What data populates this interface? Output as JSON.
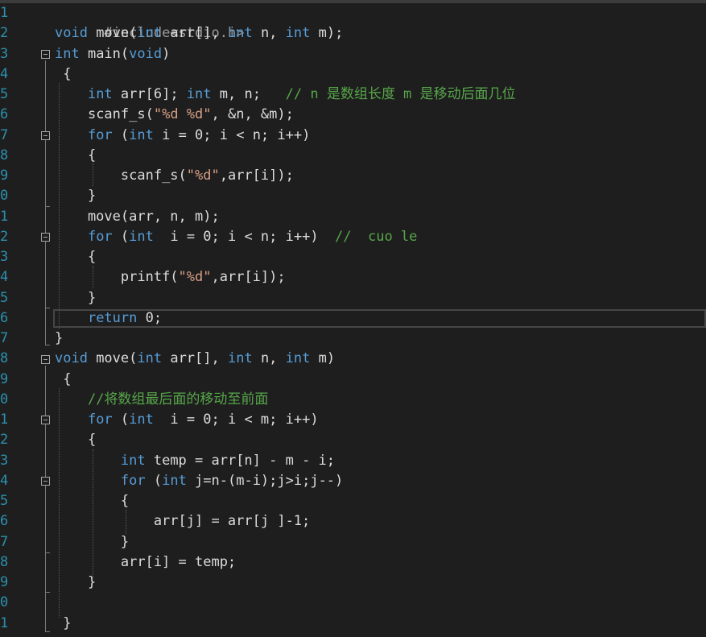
{
  "colors": {
    "background": "#1e1e1e",
    "keyword": "#569cd6",
    "comment": "#57a64a",
    "string": "#d69d85",
    "line_number": "#2b91af",
    "default_text": "#dcdcdc"
  },
  "gutter": {
    "line_numbers": [
      "1",
      "2",
      "3",
      "4",
      "5",
      "6",
      "7",
      "8",
      "9",
      "0",
      "1",
      "2",
      "3",
      "4",
      "5",
      "6",
      "7",
      "8",
      "9",
      "0",
      "1",
      "2",
      "3",
      "4",
      "5",
      "6",
      "7",
      "8",
      "9",
      "0",
      "1"
    ]
  },
  "code": {
    "line1": {
      "pp": "#include<stdio.h>"
    },
    "line2": {
      "kw1": "void",
      "t1": " move(",
      "kw2": "int",
      "t2": " arr[], ",
      "kw3": "int",
      "t3": " n, ",
      "kw4": "int",
      "t4": " m);"
    },
    "line3": {
      "kw1": "int",
      "t1": " main(",
      "kw2": "void",
      "t2": ")"
    },
    "line4": {
      "t1": " {"
    },
    "line5": {
      "t0": "    ",
      "kw1": "int",
      "t1": " arr[6]; ",
      "kw2": "int",
      "t2": " m, n;   ",
      "cm": "// n 是数组长度 m 是移动后面几位"
    },
    "line6": {
      "t0": "    ",
      "t1": "scanf_s(",
      "str": "\"%d %d\"",
      "t2": ", &n, &m);"
    },
    "line7": {
      "t0": "    ",
      "kw1": "for",
      "t1": " (",
      "kw2": "int",
      "t2": " i = 0; i < n; i++)"
    },
    "line8": {
      "t1": "    {"
    },
    "line9": {
      "t0": "        ",
      "t1": "scanf_s(",
      "str": "\"%d\"",
      "t2": ",arr[i]);"
    },
    "line10": {
      "t1": "    }"
    },
    "line11": {
      "t1": "    move(arr, n, m);"
    },
    "line12": {
      "t0": "    ",
      "kw1": "for",
      "t1": " (",
      "kw2": "int",
      "t2": "  i = 0; i < n; i++)  ",
      "cm": "//  cuo le"
    },
    "line13": {
      "t1": "    {"
    },
    "line14": {
      "t0": "        ",
      "t1": "printf(",
      "str": "\"%d\"",
      "t2": ",arr[i]);"
    },
    "line15": {
      "t1": "    }"
    },
    "line16": {
      "t0": "    ",
      "kw1": "return",
      "t1": " 0;"
    },
    "line17": {
      "t1": "}"
    },
    "line18": {
      "kw1": "void",
      "t1": " move(",
      "kw2": "int",
      "t2": " arr[], ",
      "kw3": "int",
      "t3": " n, ",
      "kw4": "int",
      "t4": " m)"
    },
    "line19": {
      "t1": " {"
    },
    "line20": {
      "t0": "    ",
      "cm": "//将数组最后面的移动至前面"
    },
    "line21": {
      "t0": "    ",
      "kw1": "for",
      "t1": " (",
      "kw2": "int",
      "t2": "  i = 0; i < m; i++)"
    },
    "line22": {
      "t1": "    {"
    },
    "line23": {
      "t0": "        ",
      "kw1": "int",
      "t1": " temp = arr[n] - m - i;"
    },
    "line24": {
      "t0": "        ",
      "kw1": "for",
      "t1": " (",
      "kw2": "int",
      "t2": " j=n-(m-i);j>i;j--)"
    },
    "line25": {
      "t1": "        {"
    },
    "line26": {
      "t1": "            arr[j] = arr[j ]-1;"
    },
    "line27": {
      "t1": "        }"
    },
    "line28": {
      "t1": "        arr[i] = temp;"
    },
    "line29": {
      "t1": "    }"
    },
    "line30": {
      "t1": ""
    },
    "line31": {
      "t1": " }"
    }
  }
}
